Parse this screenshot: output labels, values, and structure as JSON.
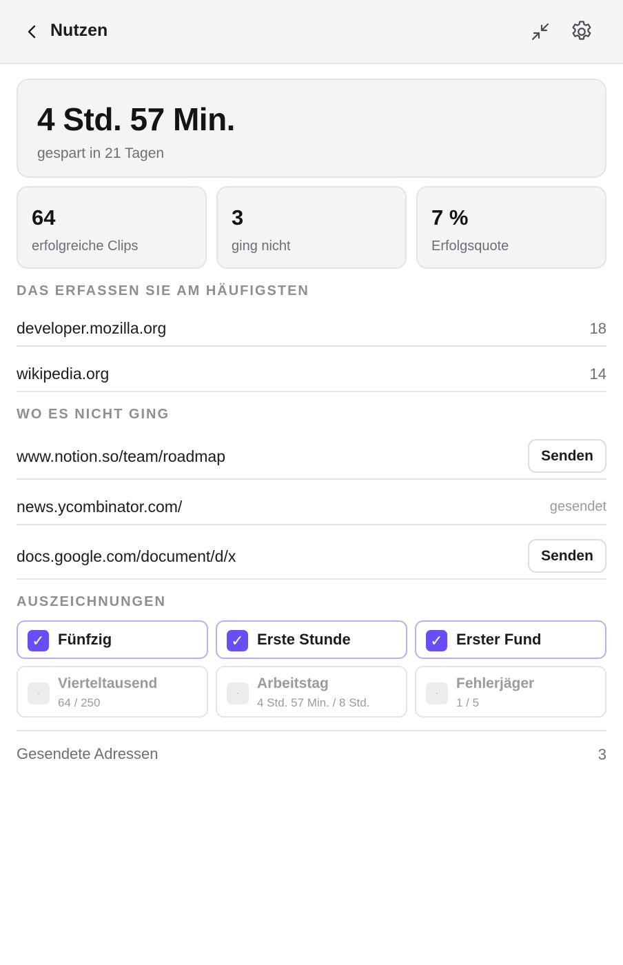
{
  "header": {
    "title": "Nutzen",
    "back_icon": "chevron-left-icon",
    "collapse_icon": "minimize-icon",
    "settings_icon": "gear-icon"
  },
  "summary": {
    "time_saved": "4 Std. 57 Min.",
    "time_saved_caption": "gespart in 21 Tagen"
  },
  "stats": [
    {
      "value": "64",
      "label": "erfolgreiche Clips"
    },
    {
      "value": "3",
      "label": "ging nicht"
    },
    {
      "value": "7 %",
      "label": "Erfolgsquote"
    }
  ],
  "top_sites": {
    "heading": "DAS ERFASSEN SIE AM HÄUFIGSTEN",
    "items": [
      {
        "domain": "developer.mozilla.org",
        "count": "18"
      },
      {
        "domain": "wikipedia.org",
        "count": "14"
      }
    ]
  },
  "failures": {
    "heading": "WO ES NICHT GING",
    "items": [
      {
        "url": "www.notion.so/team/roadmap",
        "action": "Senden"
      },
      {
        "url": "news.ycombinator.com/",
        "status": "gesendet"
      },
      {
        "url": "docs.google.com/document/d/x",
        "action": "Senden"
      }
    ]
  },
  "awards": {
    "heading": "AUSZEICHNUNGEN",
    "check_glyph": "✓",
    "lock_glyph": "·",
    "earned": [
      {
        "title": "Fünfzig"
      },
      {
        "title": "Erste Stunde"
      },
      {
        "title": "Erster Fund"
      }
    ],
    "locked": [
      {
        "title": "Vierteltausend",
        "progress": "64 / 250"
      },
      {
        "title": "Arbeitstag",
        "progress": "4 Std. 57 Min. / 8 Std."
      },
      {
        "title": "Fehlerjäger",
        "progress": "1 / 5"
      }
    ]
  },
  "footer": {
    "label": "Gesendete Adressen",
    "count": "3"
  },
  "colors": {
    "accent": "#6a4ef5",
    "accent_border": "#b8aef0",
    "header_bg": "#f5f5f7",
    "card_bg": "#f4f4f6",
    "muted_text": "#6e6e73"
  }
}
